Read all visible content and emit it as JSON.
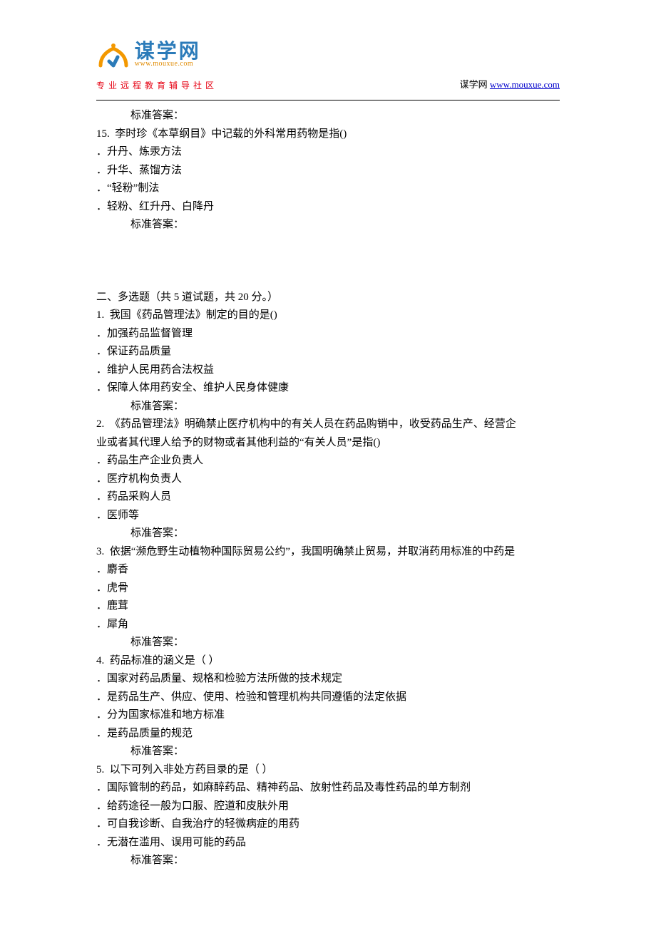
{
  "header": {
    "logo_cn": "谋学网",
    "logo_url": "www.mouxue.com",
    "tagline": "专业远程教育辅导社区",
    "right_label": "谋学网",
    "right_link": "www.mouxue.com"
  },
  "body": {
    "answer_label": "标准答案：",
    "q15": {
      "num": "15.",
      "stem": "李时珍《本草纲目》中记载的外科常用药物是指()",
      "opts": [
        "．升丹、炼汞方法",
        "．升华、蒸馏方法",
        "．“轻粉”制法",
        "．轻粉、红升丹、白降丹"
      ]
    },
    "section2": {
      "title": "二、多选题（共 5 道试题，共 20 分。）"
    },
    "mq1": {
      "num": "1.",
      "stem": "我国《药品管理法》制定的目的是()",
      "opts": [
        "．加强药品监督管理",
        "．保证药品质量",
        "．维护人民用药合法权益",
        "．保障人体用药安全、维护人民身体健康"
      ]
    },
    "mq2": {
      "num": "2.",
      "stem_line1": "《药品管理法》明确禁止医疗机构中的有关人员在药品购销中，收受药品生产、经营企",
      "stem_line2": "业或者其代理人给予的财物或者其他利益的“有关人员”是指()",
      "opts": [
        "．药品生产企业负责人",
        "．医疗机构负责人",
        "．药品采购人员",
        "．医师等"
      ]
    },
    "mq3": {
      "num": "3.",
      "stem": "依据“濒危野生动植物种国际贸易公约”，我国明确禁止贸易，并取消药用标准的中药是",
      "opts": [
        "．麝香",
        "．虎骨",
        "．鹿茸",
        "．犀角"
      ]
    },
    "mq4": {
      "num": "4.",
      "stem": "药品标准的涵义是（ ）",
      "opts": [
        "．国家对药品质量、规格和检验方法所做的技术规定",
        "．是药品生产、供应、使用、检验和管理机构共同遵循的法定依据",
        "．分为国家标准和地方标准",
        "．是药品质量的规范"
      ]
    },
    "mq5": {
      "num": "5.",
      "stem": "以下可列入非处方药目录的是（ ）",
      "opts": [
        "．国际管制的药品，如麻醉药品、精神药品、放射性药品及毒性药品的单方制剂",
        "．给药途径一般为口服、腔道和皮肤外用",
        "．可自我诊断、自我治疗的轻微病症的用药",
        "．无潜在滥用、误用可能的药品"
      ]
    }
  }
}
